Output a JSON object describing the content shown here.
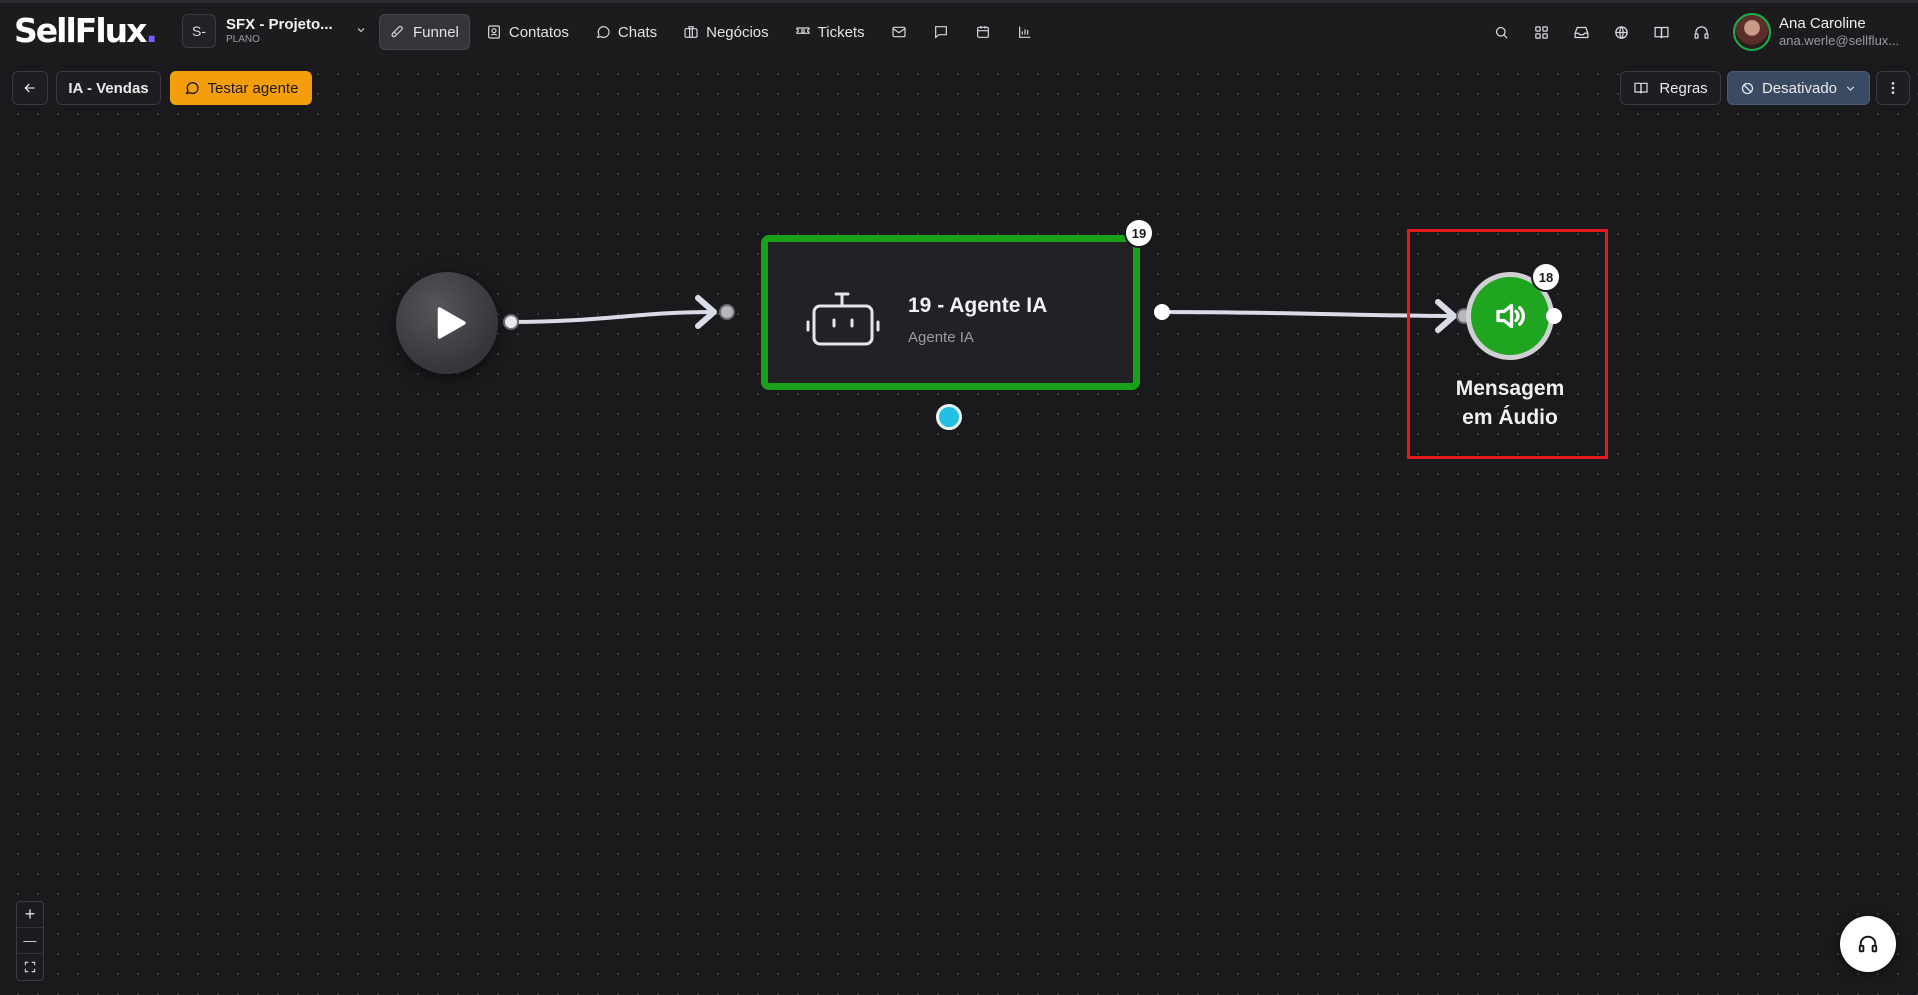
{
  "app": {
    "logo_main": "SellFlux",
    "logo_dot": "."
  },
  "workspace": {
    "badge": "S-",
    "name": "SFX - Projeto...",
    "plan": "PLANO"
  },
  "nav": {
    "items": [
      {
        "label": "Funnel",
        "icon": "rocket-icon",
        "active": true
      },
      {
        "label": "Contatos",
        "icon": "contacts-icon"
      },
      {
        "label": "Chats",
        "icon": "chat-bubble-icon"
      },
      {
        "label": "Negócios",
        "icon": "briefcase-icon"
      },
      {
        "label": "Tickets",
        "icon": "ticket-icon"
      }
    ],
    "mini_icons": [
      "mail-icon",
      "message-square-icon",
      "calendar-icon",
      "bar-chart-icon"
    ]
  },
  "header_right": {
    "icons": [
      "search-icon",
      "apps-grid-icon",
      "inbox-icon",
      "globe-icon",
      "book-icon",
      "headset-icon"
    ]
  },
  "user": {
    "name": "Ana Caroline",
    "email": "ana.werle@sellflux..."
  },
  "toolbar": {
    "flow_name": "IA - Vendas",
    "test_label": "Testar agente",
    "rules_label": "Regras",
    "status_label": "Desativado",
    "more_icon": "more-vertical-icon"
  },
  "nodes": {
    "start": {
      "icon": "play-icon"
    },
    "agent": {
      "title": "19 - Agente IA",
      "subtitle": "Agente IA",
      "count": "19",
      "icon": "robot-icon"
    },
    "audio": {
      "label_line1": "Mensagem",
      "label_line2": "em Áudio",
      "count": "18",
      "icon": "speaker-icon"
    }
  },
  "zoom": {
    "in": "+",
    "out": "—"
  },
  "colors": {
    "accent_green": "#1aa11a",
    "test_orange": "#f59e0b",
    "status_blue": "#3b4a63",
    "highlight_red": "#e11b1b",
    "cyan_handle": "#22c1e4"
  }
}
